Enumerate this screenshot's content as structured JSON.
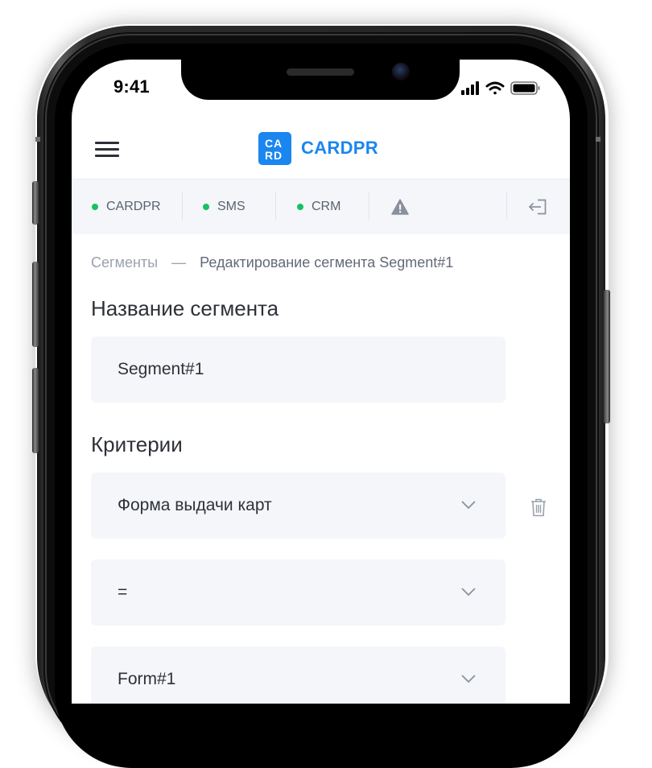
{
  "status_bar": {
    "time": "9:41"
  },
  "header": {
    "logo_text": "CARDPR",
    "logo_mark": "CARD"
  },
  "systems": [
    {
      "label": "CARDPR",
      "status": "online"
    },
    {
      "label": "SMS",
      "status": "online"
    },
    {
      "label": "CRM",
      "status": "online"
    }
  ],
  "breadcrumb": {
    "parent": "Сегменты",
    "separator": "—",
    "current": "Редактирование сегмента Segment#1"
  },
  "segment_name": {
    "title": "Название сегмента",
    "value": "Segment#1"
  },
  "criteria": {
    "title": "Критерии",
    "field": "Форма выдачи карт",
    "operator": "=",
    "value": "Form#1"
  },
  "colors": {
    "accent": "#1a86f0",
    "status_ok": "#18c064",
    "field_bg": "#f4f6fa"
  }
}
